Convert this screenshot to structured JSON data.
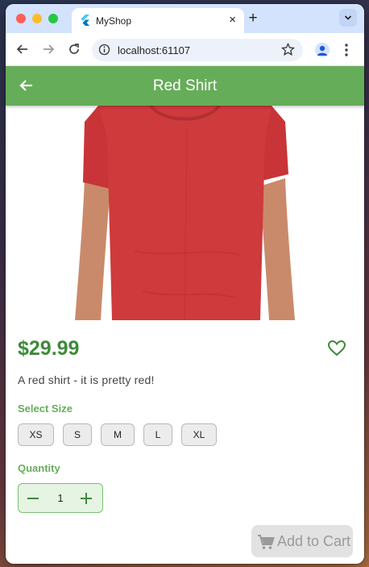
{
  "browser": {
    "tab_title": "MyShop",
    "tab_close": "×",
    "new_tab": "+",
    "url": "localhost:61107",
    "tab_menu_icon": "chevron-down-icon"
  },
  "appbar": {
    "title": "Red Shirt",
    "back_icon": "arrow-back-icon"
  },
  "product": {
    "image_alt": "red-t-shirt-photo",
    "shirt_color": "#cf3a3c",
    "price": "$29.99",
    "description": "A red shirt - it is pretty red!",
    "favorite_icon": "heart-outline-icon"
  },
  "size": {
    "label": "Select Size",
    "options": [
      "XS",
      "S",
      "M",
      "L",
      "XL"
    ]
  },
  "quantity": {
    "label": "Quantity",
    "value": "1",
    "minus_icon": "minus-icon",
    "plus_icon": "plus-icon"
  },
  "cart": {
    "label": "Add to Cart",
    "icon": "shopping-cart-icon"
  },
  "colors": {
    "accent": "#66ad59",
    "price": "#3f8a3a",
    "disabled": "#9a9a9a"
  }
}
